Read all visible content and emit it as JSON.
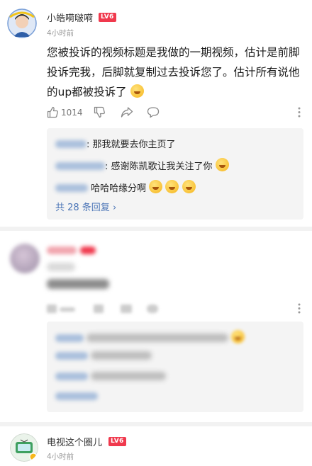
{
  "comment1": {
    "username": "小皓嗬啵嗬",
    "level": "LV6",
    "time": "4小时前",
    "body_line1": "您被投诉的视频标题是我做的一期视频，估计是前脚",
    "body_line2": "投诉完我，后脚就复制过去投诉您了。估计所有说他",
    "body_line3": "的up都被投诉了",
    "like_count": "1014",
    "replies": [
      {
        "text": ": 那我就要去你主页了"
      },
      {
        "text": ": 感谢陈凯歌让我关注了你"
      },
      {
        "text": "哈哈哈缘分啊"
      }
    ],
    "more_replies": "共 28 条回复",
    "more_arrow": "›"
  },
  "comment3": {
    "username": "电视这个圈儿",
    "level": "LV6",
    "time": "4小时前"
  },
  "colors": {
    "level_badge": "#f0394d",
    "link_blue": "#4a74b6",
    "reply_bg": "#f4f4f4"
  },
  "icons": {
    "like": "thumbs-up-icon",
    "dislike": "thumbs-down-icon",
    "share": "share-icon",
    "reply": "comment-bubble-icon",
    "more": "more-vertical-icon"
  }
}
